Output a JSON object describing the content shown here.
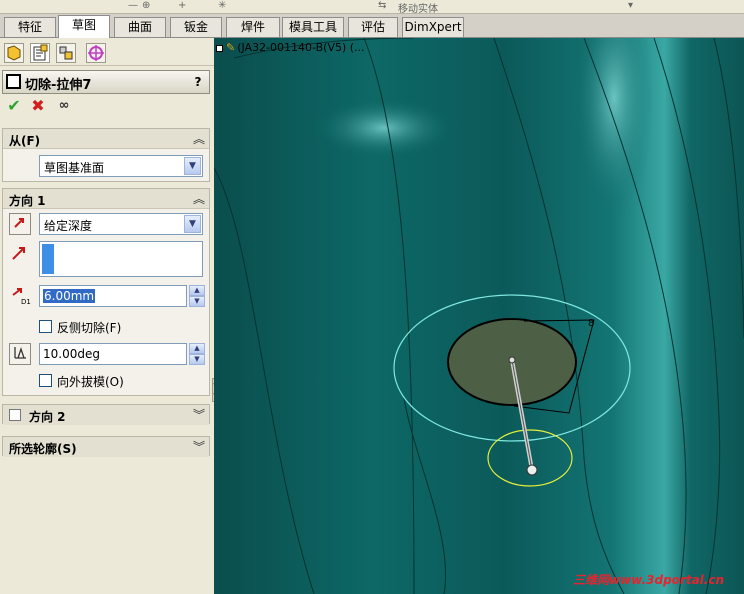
{
  "topbar": {
    "move_label": "移动实体"
  },
  "tabs": [
    {
      "label": "特征",
      "active": false
    },
    {
      "label": "草图",
      "active": true
    },
    {
      "label": "曲面",
      "active": false
    },
    {
      "label": "钣金",
      "active": false
    },
    {
      "label": "焊件",
      "active": false
    },
    {
      "label": "模具工具",
      "active": false
    },
    {
      "label": "评估",
      "active": false
    },
    {
      "label": "DimXpert",
      "active": false
    }
  ],
  "feature": {
    "title": "切除-拉伸7",
    "help": "?"
  },
  "from_group": {
    "label": "从(F)",
    "condition": "草图基准面"
  },
  "direction1": {
    "label": "方向 1",
    "end_condition": "给定深度",
    "depth": "6.00mm",
    "flip_side_label": "反侧切除(F)",
    "draft_angle": "10.00deg",
    "draft_outward_label": "向外拔模(O)"
  },
  "direction2": {
    "label": "方向 2"
  },
  "contours_group": {
    "label": "所选轮廓(S)"
  },
  "viewport": {
    "tree_label": "(JA32-001140-B(V5) (...",
    "watermark": "三维网www.3dportal.cn"
  },
  "colors": {
    "body": "#0b5b5a",
    "face": "#4d5f45",
    "sketch_circle": "#7fe8e0",
    "sketch_point_circle": "#e6f03c"
  }
}
